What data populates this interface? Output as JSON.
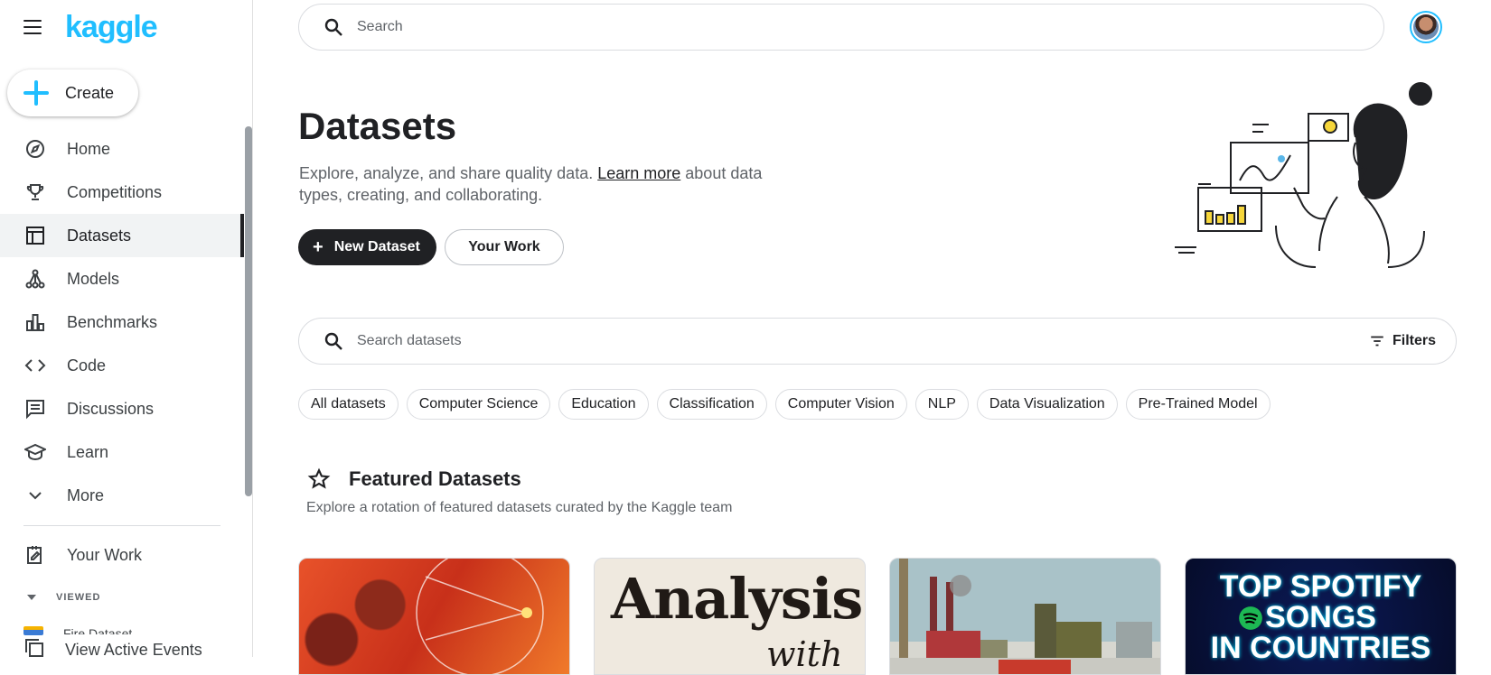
{
  "brand": {
    "name": "kaggle"
  },
  "create": {
    "label": "Create"
  },
  "sidebar": {
    "items": [
      {
        "label": "Home",
        "icon": "compass-icon"
      },
      {
        "label": "Competitions",
        "icon": "trophy-icon"
      },
      {
        "label": "Datasets",
        "icon": "table-icon",
        "active": true
      },
      {
        "label": "Models",
        "icon": "models-icon"
      },
      {
        "label": "Benchmarks",
        "icon": "bar-chart-icon"
      },
      {
        "label": "Code",
        "icon": "code-icon"
      },
      {
        "label": "Discussions",
        "icon": "comment-icon"
      },
      {
        "label": "Learn",
        "icon": "school-icon"
      },
      {
        "label": "More",
        "icon": "chevron-down-icon"
      }
    ],
    "your_work": "Your Work",
    "viewed_label": "VIEWED",
    "viewed_item_partial": "Fire Dataset",
    "view_active_events": "View Active Events"
  },
  "topbar": {
    "search_placeholder": "Search"
  },
  "page": {
    "title": "Datasets",
    "desc_before": "Explore, analyze, and share quality data. ",
    "desc_link": "Learn more",
    "desc_after": " about data types, creating, and collaborating.",
    "new_dataset": "New Dataset",
    "your_work": "Your Work"
  },
  "dataset_search": {
    "placeholder": "Search datasets",
    "filters": "Filters"
  },
  "chips": [
    "All datasets",
    "Computer Science",
    "Education",
    "Classification",
    "Computer Vision",
    "NLP",
    "Data Visualization",
    "Pre-Trained Model"
  ],
  "featured": {
    "title": "Featured Datasets",
    "subtitle": "Explore a rotation of featured datasets curated by the Kaggle team"
  },
  "cards": {
    "c2_word": "Analysis",
    "c2_word2": "with",
    "c4_line1": "TOP SPOTIFY",
    "c4_line2": "SONGS",
    "c4_line3": "IN COUNTRIES"
  },
  "colors": {
    "brand": "#20beff",
    "primary_button": "#202124"
  }
}
